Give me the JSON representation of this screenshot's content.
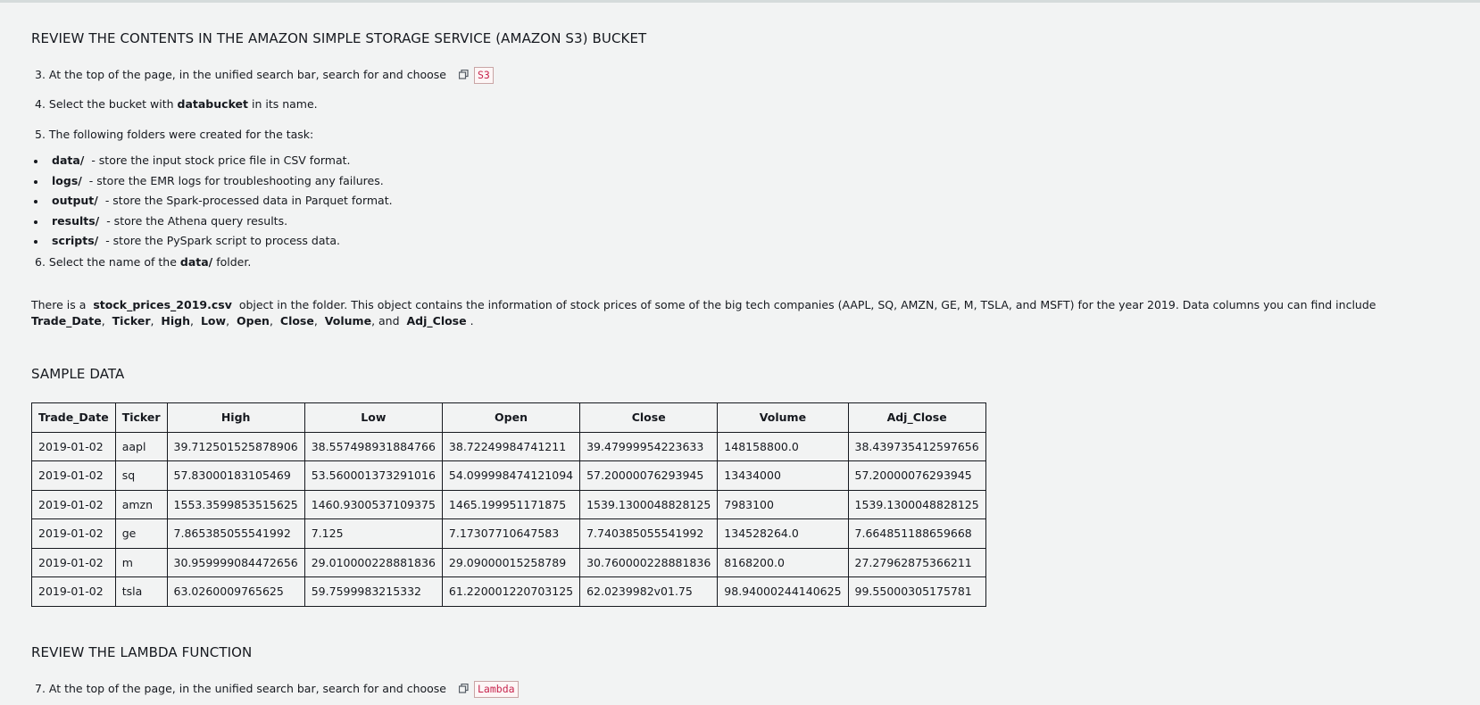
{
  "section1": {
    "heading": "REVIEW THE CONTENTS IN THE AMAZON SIMPLE STORAGE SERVICE (AMAZON S3) BUCKET",
    "step3": {
      "text": "3. At the top of the page, in the unified search bar, search for and choose",
      "chip": "S3"
    },
    "step4": {
      "pre": "4. Select the bucket with",
      "bold": "databucket",
      "post": "in its name."
    },
    "step5": "5. The following folders were created for the task:",
    "folders": [
      {
        "name": "data/",
        "desc": "- store the input stock price file in CSV format."
      },
      {
        "name": "logs/",
        "desc": "- store the EMR logs for troubleshooting any failures."
      },
      {
        "name": "output/",
        "desc": "- store the Spark-processed data in Parquet format."
      },
      {
        "name": "results/",
        "desc": "- store the Athena query results."
      },
      {
        "name": "scripts/",
        "desc": "- store the PySpark script to process data."
      }
    ],
    "step6": {
      "pre": "6. Select the name of the",
      "bold": "data/",
      "post": "folder."
    },
    "para": {
      "p1": "There is a",
      "file": "stock_prices_2019.csv",
      "p2": "object in the folder. This object contains the information of stock prices of some of the big tech companies (AAPL, SQ, AMZN, GE, M, TSLA, and MSFT) for the year 2019. Data columns you can find include",
      "cols": [
        "Trade_Date",
        "Ticker",
        "High",
        "Low",
        "Open",
        "Close",
        "Volume",
        "Adj_Close"
      ],
      "sep": ",",
      "and": ", and",
      "end": "."
    }
  },
  "section2": {
    "heading": "SAMPLE DATA",
    "columns": [
      "Trade_Date",
      "Ticker",
      "High",
      "Low",
      "Open",
      "Close",
      "Volume",
      "Adj_Close"
    ],
    "rows": [
      [
        "2019-01-02",
        "aapl",
        "39.712501525878906",
        "38.557498931884766",
        "38.72249984741211",
        "39.47999954223633",
        "148158800.0",
        "38.439735412597656"
      ],
      [
        "2019-01-02",
        "sq",
        "57.83000183105469",
        "53.560001373291016",
        "54.099998474121094",
        "57.20000076293945",
        "13434000",
        "57.20000076293945"
      ],
      [
        "2019-01-02",
        "amzn",
        "1553.3599853515625",
        "1460.9300537109375",
        "1465.199951171875",
        "1539.1300048828125",
        "7983100",
        "1539.1300048828125"
      ],
      [
        "2019-01-02",
        "ge",
        "7.865385055541992",
        "7.125",
        "7.17307710647583",
        "7.740385055541992",
        "134528264.0",
        "7.664851188659668"
      ],
      [
        "2019-01-02",
        "m",
        "30.959999084472656",
        "29.010000228881836",
        "29.09000015258789",
        "30.760000228881836",
        "8168200.0",
        "27.27962875366211"
      ],
      [
        "2019-01-02",
        "tsla",
        "63.0260009765625",
        "59.7599983215332",
        "61.220001220703125",
        "62.0239982v01.75",
        "98.94000244140625",
        "99.55000305175781"
      ]
    ]
  },
  "section3": {
    "heading": "REVIEW THE LAMBDA FUNCTION",
    "step7": {
      "text": "7. At the top of the page, in the unified search bar, search for and choose",
      "chip": "Lambda"
    }
  },
  "icons": {
    "copy": "copy-icon"
  },
  "colors": {
    "chip_text": "#c7254e",
    "background": "#f2f3f3"
  }
}
